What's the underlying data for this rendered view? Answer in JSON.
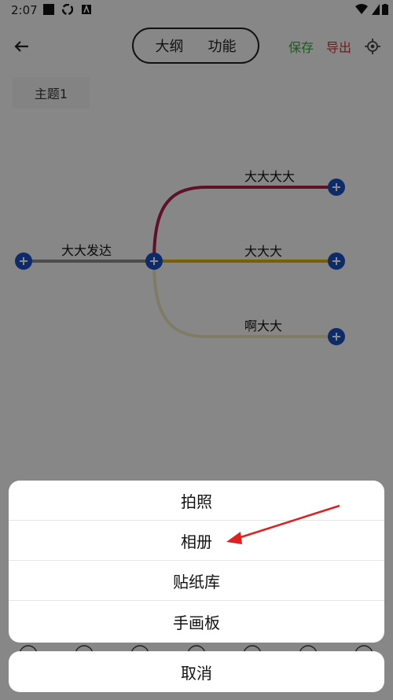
{
  "status_bar": {
    "time": "2:07"
  },
  "toolbar": {
    "tabs": [
      "大纲",
      "功能"
    ],
    "save": "保存",
    "export": "导出"
  },
  "topic_tab": "主题1",
  "mindmap": {
    "root_label": "大大发达",
    "children": [
      "大大大大",
      "大大大",
      "啊大大"
    ],
    "colors": {
      "root_line": "#8a8a8a",
      "child1": "#b0204e",
      "child2": "#e0b000",
      "child3": "#e8e0b6",
      "node": "#1b4fbf"
    }
  },
  "sheet": {
    "options": [
      "拍照",
      "相册",
      "贴纸库",
      "手画板"
    ],
    "cancel": "取消"
  },
  "colors": {
    "arrow": "#e02020",
    "save": "#3aa13a",
    "export": "#d93030"
  }
}
